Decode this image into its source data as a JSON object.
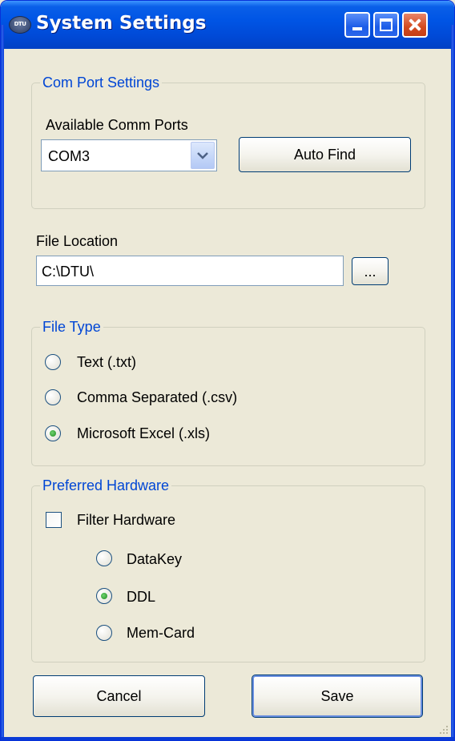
{
  "window": {
    "title": "System Settings",
    "icon_label": "DTU",
    "icon": "dtu-app-icon"
  },
  "titlebar_buttons": {
    "minimize_icon": "minimize-icon",
    "maximize_icon": "maximize-icon",
    "close_icon": "close-icon"
  },
  "com_port": {
    "legend": "Com Port Settings",
    "available_label": "Available Comm Ports",
    "selected_port": "COM3",
    "auto_find_label": "Auto Find"
  },
  "file_location": {
    "label": "File Location",
    "value": "C:\\DTU\\",
    "browse_label": "..."
  },
  "file_type": {
    "legend": "File Type",
    "options": [
      {
        "label": "Text (.txt)",
        "checked": false
      },
      {
        "label": "Comma Separated (.csv)",
        "checked": false
      },
      {
        "label": "Microsoft Excel (.xls)",
        "checked": true
      }
    ]
  },
  "hardware": {
    "legend": "Preferred Hardware",
    "filter_label": "Filter Hardware",
    "filter_checked": false,
    "options": [
      {
        "label": "DataKey",
        "checked": false
      },
      {
        "label": "DDL",
        "checked": true
      },
      {
        "label": "Mem-Card",
        "checked": false
      }
    ]
  },
  "footer": {
    "cancel_label": "Cancel",
    "save_label": "Save"
  },
  "colors": {
    "title_blue": "#0055e5",
    "legend_blue": "#0046d5",
    "window_bg": "#ece9d8",
    "radio_green": "#1f8a1f"
  }
}
